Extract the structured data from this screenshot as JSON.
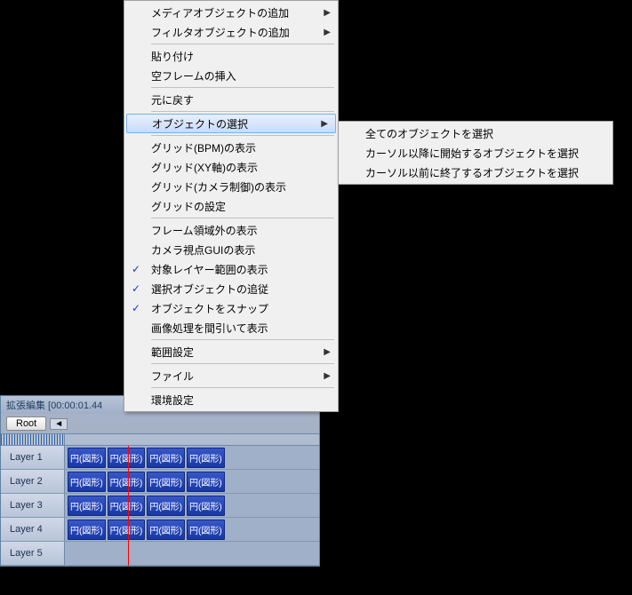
{
  "timeline": {
    "title": "拡張編集 [00:00:01.44",
    "root_btn": "Root",
    "layers": [
      {
        "label": "Layer 1",
        "clips": [
          "円(図形)",
          "円(図形)",
          "円(図形)",
          "円(図形)"
        ]
      },
      {
        "label": "Layer 2",
        "clips": [
          "円(図形)",
          "円(図形)",
          "円(図形)",
          "円(図形)"
        ]
      },
      {
        "label": "Layer 3",
        "clips": [
          "円(図形)",
          "円(図形)",
          "円(図形)",
          "円(図形)"
        ]
      },
      {
        "label": "Layer 4",
        "clips": [
          "円(図形)",
          "円(図形)",
          "円(図形)",
          "円(図形)"
        ]
      },
      {
        "label": "Layer 5",
        "clips": []
      }
    ]
  },
  "menu": {
    "media_add": "メディアオブジェクトの追加",
    "filter_add": "フィルタオブジェクトの追加",
    "paste": "貼り付け",
    "empty_frame": "空フレームの挿入",
    "undo": "元に戻す",
    "select_obj": "オブジェクトの選択",
    "grid_bpm": "グリッド(BPM)の表示",
    "grid_xy": "グリッド(XY軸)の表示",
    "grid_camera": "グリッド(カメラ制御)の表示",
    "grid_settings": "グリッドの設定",
    "frame_outside": "フレーム領域外の表示",
    "camera_gui": "カメラ視点GUIの表示",
    "layer_range": "対象レイヤー範囲の表示",
    "track_selected": "選択オブジェクトの追従",
    "snap": "オブジェクトをスナップ",
    "thinned": "画像処理を間引いて表示",
    "range_settings": "範囲設定",
    "file": "ファイル",
    "env_settings": "環境設定"
  },
  "submenu": {
    "select_all": "全てのオブジェクトを選択",
    "select_after": "カーソル以降に開始するオブジェクトを選択",
    "select_before": "カーソル以前に終了するオブジェクトを選択"
  }
}
